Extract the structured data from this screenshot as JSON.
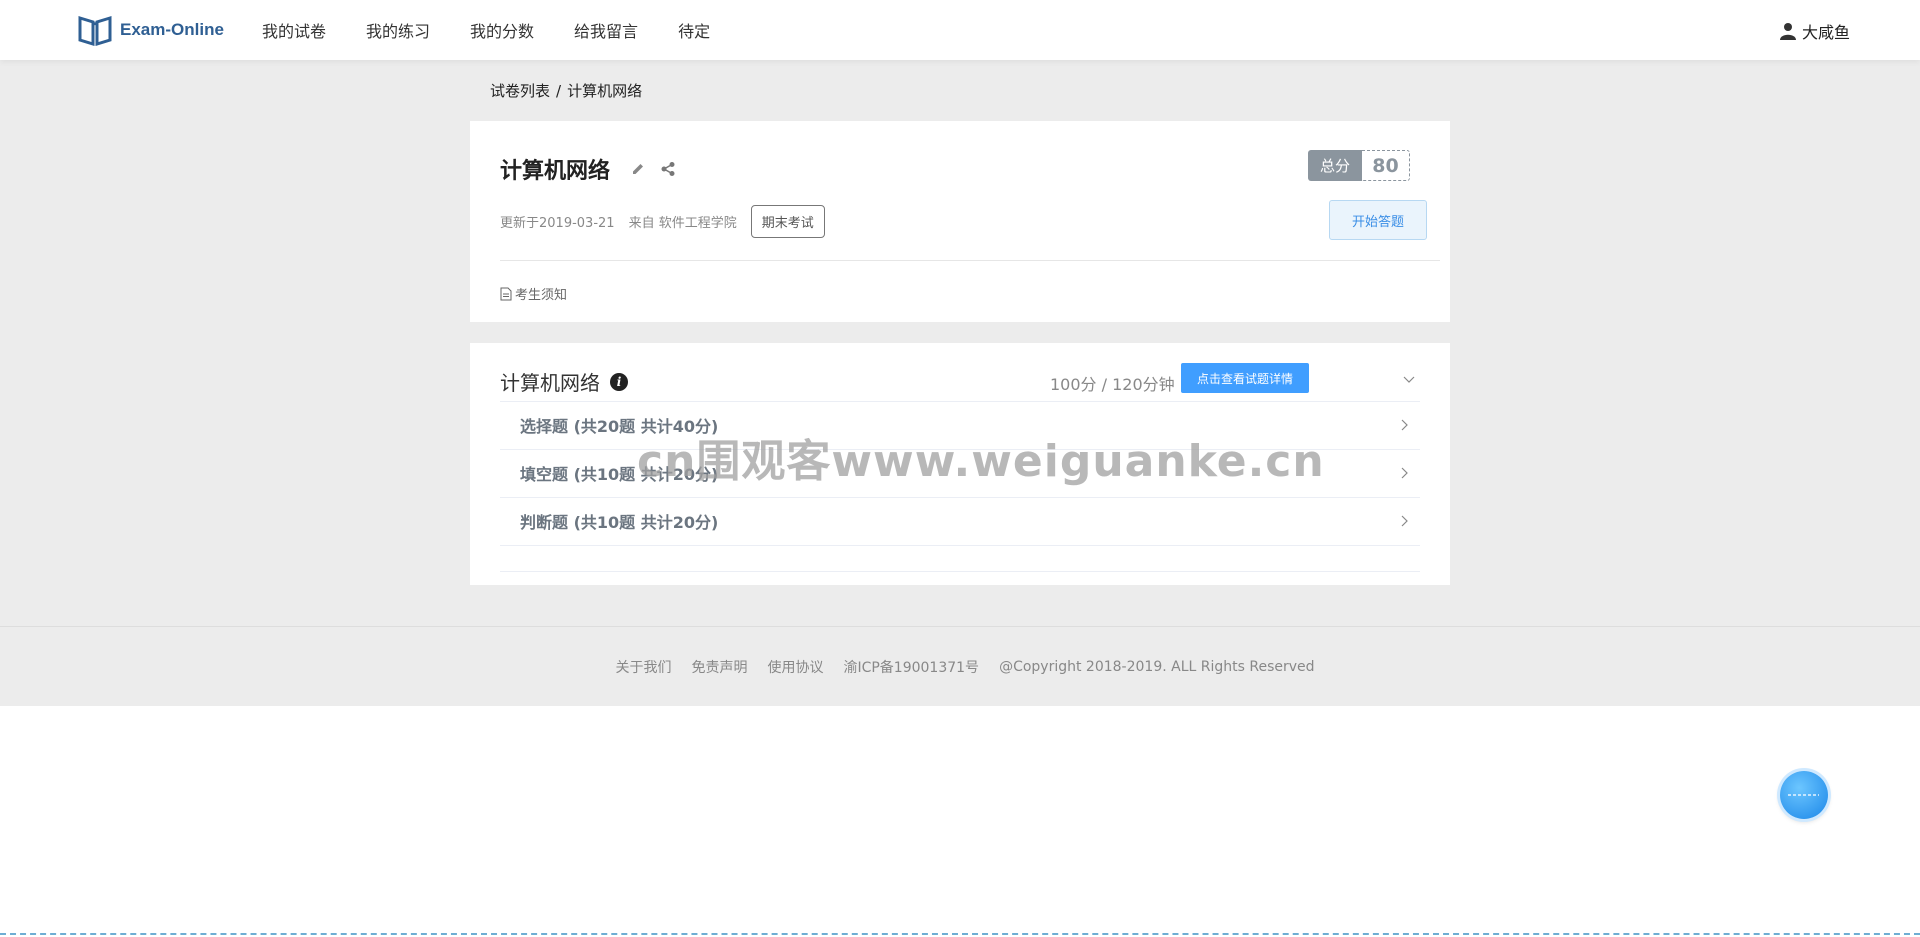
{
  "header": {
    "brand": "Exam-Online",
    "nav": [
      {
        "label": "我的试卷"
      },
      {
        "label": "我的练习"
      },
      {
        "label": "我的分数"
      },
      {
        "label": "给我留言"
      },
      {
        "label": "待定"
      }
    ],
    "user_name": "大咸鱼"
  },
  "breadcrumb": {
    "parent": "试卷列表",
    "separator": "/",
    "current": "计算机网络"
  },
  "exam": {
    "title": "计算机网络",
    "score_label": "总分",
    "score_value": "80",
    "updated": "更新于2019-03-21",
    "source": "来自 软件工程学院",
    "tag": "期末考试",
    "start_button": "开始答题",
    "notice_link": "考生须知"
  },
  "section": {
    "title": "计算机网络",
    "score_time": "100分 / 120分钟",
    "detail_button": "点击查看试题详情",
    "questions": [
      {
        "label": "选择题 (共20题 共计40分)"
      },
      {
        "label": "填空题 (共10题 共计20分)"
      },
      {
        "label": "判断题 (共10题 共计20分)"
      }
    ]
  },
  "footer": {
    "links": [
      "关于我们",
      "免责声明",
      "使用协议",
      "渝ICP备19001371号"
    ],
    "copyright": "@Copyright 2018-2019. ALL Rights Reserved"
  },
  "watermark": "cn围观客www.weiguanke.cn",
  "colors": {
    "brand": "#2f5f93",
    "primary": "#409eff",
    "score_gray": "#8b959e"
  }
}
